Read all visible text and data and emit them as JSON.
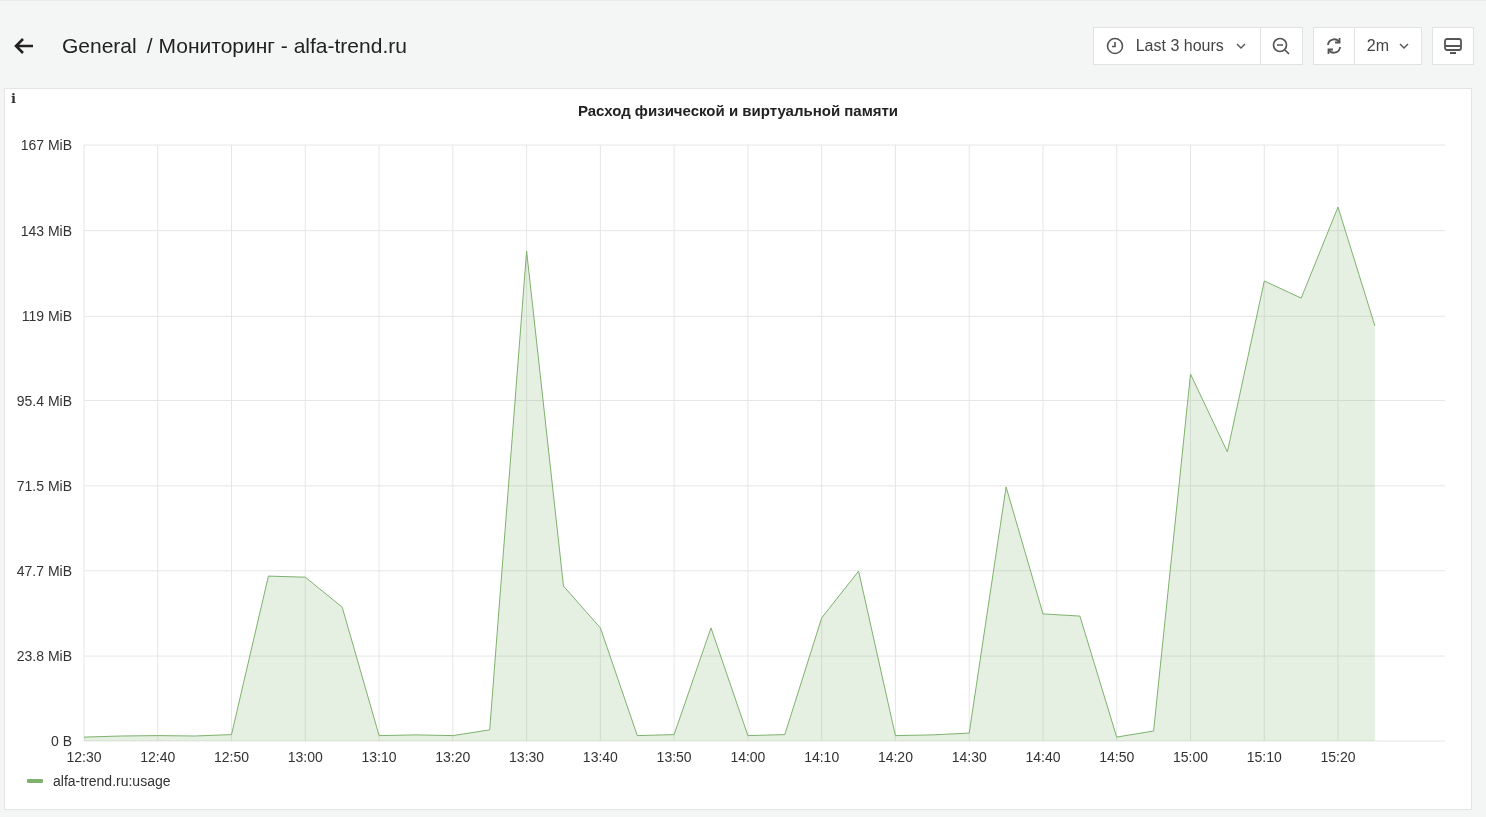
{
  "breadcrumb": {
    "folder": "General",
    "separator": "/",
    "title": "Мониторинг - alfa-trend.ru"
  },
  "toolbar": {
    "time_range": "Last 3 hours",
    "refresh_interval": "2m"
  },
  "panel": {
    "info_mark": "i",
    "title": "Расход физической и виртуальной памяти",
    "chart_data": {
      "type": "area",
      "categories": [
        "12:30",
        null,
        "12:40",
        null,
        "12:50",
        null,
        "13:00",
        null,
        "13:10",
        null,
        "13:20",
        null,
        "13:30",
        null,
        "13:40",
        null,
        "13:50",
        null,
        "14:00",
        null,
        "14:10",
        null,
        "14:20",
        null,
        "14:30",
        null,
        "14:40",
        null,
        "14:50",
        null,
        "15:00",
        null,
        "15:10",
        null,
        "15:20",
        null
      ],
      "series": [
        {
          "name": "alfa-trend.ru:usage",
          "color": "#7eb26d",
          "values": [
            1.1,
            1.4,
            1.5,
            1.4,
            1.8,
            46.2,
            45.9,
            37.5,
            1.5,
            1.7,
            1.5,
            3.1,
            137.3,
            43.4,
            31.7,
            1.5,
            1.8,
            31.7,
            1.5,
            1.8,
            34.5,
            47.6,
            1.5,
            1.7,
            2.2,
            71.2,
            35.6,
            35.0,
            1.1,
            2.8,
            102.8,
            81.0,
            128.9,
            124.1,
            149.6,
            116.3
          ]
        }
      ],
      "ylim": [
        0,
        167
      ],
      "grid": true,
      "yticks": [
        {
          "value": 0,
          "label": "0 B"
        },
        {
          "value": 23.8,
          "label": "23.8 MiB"
        },
        {
          "value": 47.7,
          "label": "47.7 MiB"
        },
        {
          "value": 71.5,
          "label": "71.5 MiB"
        },
        {
          "value": 95.4,
          "label": "95.4 MiB"
        },
        {
          "value": 119,
          "label": "119 MiB"
        },
        {
          "value": 143,
          "label": "143 MiB"
        },
        {
          "value": 167,
          "label": "167 MiB"
        }
      ]
    }
  }
}
